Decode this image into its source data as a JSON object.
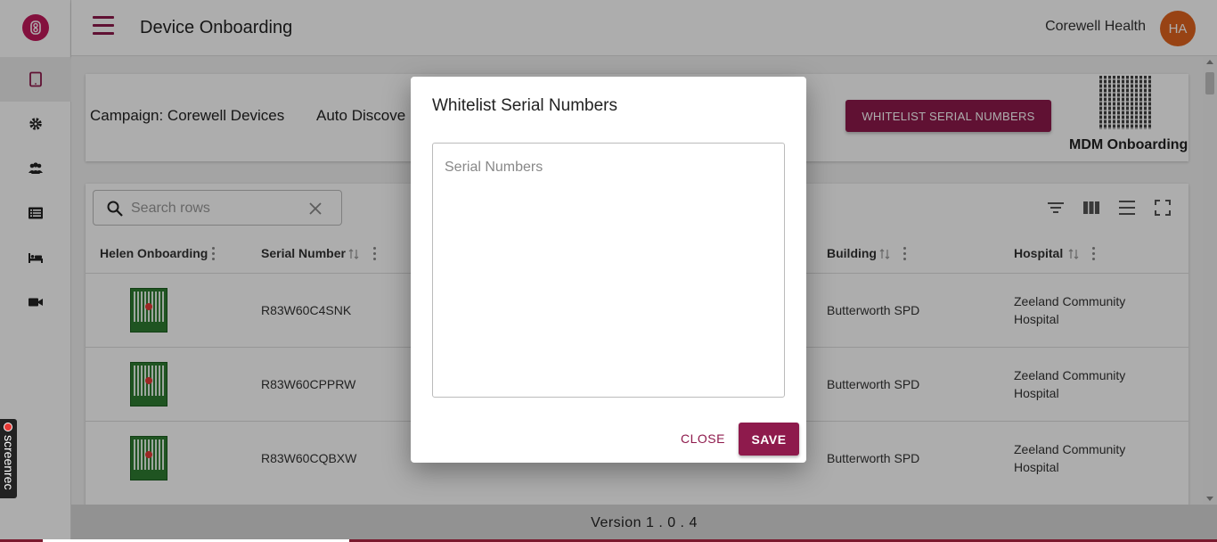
{
  "app": {
    "page_title": "Device Onboarding",
    "org_name": "Corewell Health",
    "avatar_initials": "HA",
    "accent_color": "#8e1a4c",
    "avatar_color": "#e0641e"
  },
  "rail": {
    "items": [
      {
        "icon": "tablet-icon",
        "active": true
      },
      {
        "icon": "gear-icon",
        "active": false
      },
      {
        "icon": "users-icon",
        "active": false
      },
      {
        "icon": "list-icon",
        "active": false
      },
      {
        "icon": "bed-icon",
        "active": false
      },
      {
        "icon": "video-camera-icon",
        "active": false
      }
    ]
  },
  "campaign": {
    "label": "Campaign: Corewell Devices",
    "auto_label": "Auto Discove",
    "whitelist_button": "WHITELIST SERIAL NUMBERS",
    "mdm_label": "MDM Onboarding"
  },
  "table": {
    "search_placeholder": "Search rows",
    "columns": {
      "helen": "Helen Onboarding",
      "serial": "Serial Number",
      "building": "Building",
      "hospital": "Hospital"
    },
    "rows": [
      {
        "serial": "R83W60C4SNK",
        "building": "Butterworth SPD",
        "hospital_line1": "Zeeland Community",
        "hospital_line2": "Hospital"
      },
      {
        "serial": "R83W60CPPRW",
        "building": "Butterworth SPD",
        "hospital_line1": "Zeeland Community",
        "hospital_line2": "Hospital"
      },
      {
        "serial": "R83W60CQBXW",
        "building": "Butterworth SPD",
        "hospital_line1": "Zeeland Community",
        "hospital_line2": "Hospital"
      }
    ]
  },
  "footer": {
    "version": "Version 1 . 0 . 4"
  },
  "dialog": {
    "title": "Whitelist Serial Numbers",
    "textarea_placeholder": "Serial Numbers",
    "textarea_value": "",
    "close_label": "CLOSE",
    "save_label": "SAVE"
  },
  "screenrec": {
    "label": "screenrec"
  }
}
